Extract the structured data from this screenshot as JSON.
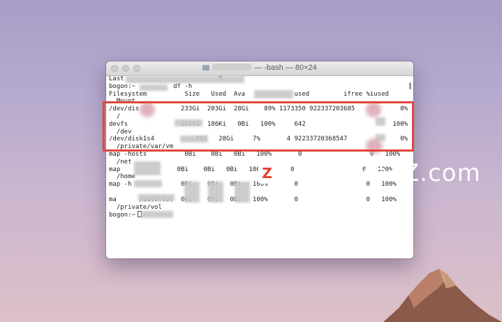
{
  "window": {
    "title_suffix": "— -bash — 80×24"
  },
  "terminal": {
    "lines": [
      "Last                         9",
      "bogon:~          df -h",
      "Filesystem          Size   Used  Ava             used         ifree %iused",
      "  Mount",
      "/dev/dis           233Gi  203Gi  28Gi    89% 1173350 922337203685            0%",
      "  /",
      "devfs              186Ki  186Ki   0Bi   100%     642                       100%",
      "  /dev",
      "/dev/disk1s4          .0Gi   28Gi     7%       4 92233720368547              0%",
      "  /private/var/vm",
      "map -hosts          0Bi    0Bi   0Bi   100%       0                  0   100%",
      "  /net",
      "map               0Bi    0Bi   0Bi   100%       0                  0   100%",
      "  /home",
      "map -h             0Bi    0Bi   0Bi   100%       0                  0   100%",
      "",
      "ma      /auto.vol  0Bi    0Bi   0Bi   100%       0                  0   100%",
      "  /private/vol",
      "bogon:~"
    ]
  },
  "watermark": {
    "logo_letter": "Z",
    "text": "www.MacZ.com"
  },
  "colors": {
    "highlight": "#e2453c",
    "watermark_logo": "#e0442f"
  }
}
